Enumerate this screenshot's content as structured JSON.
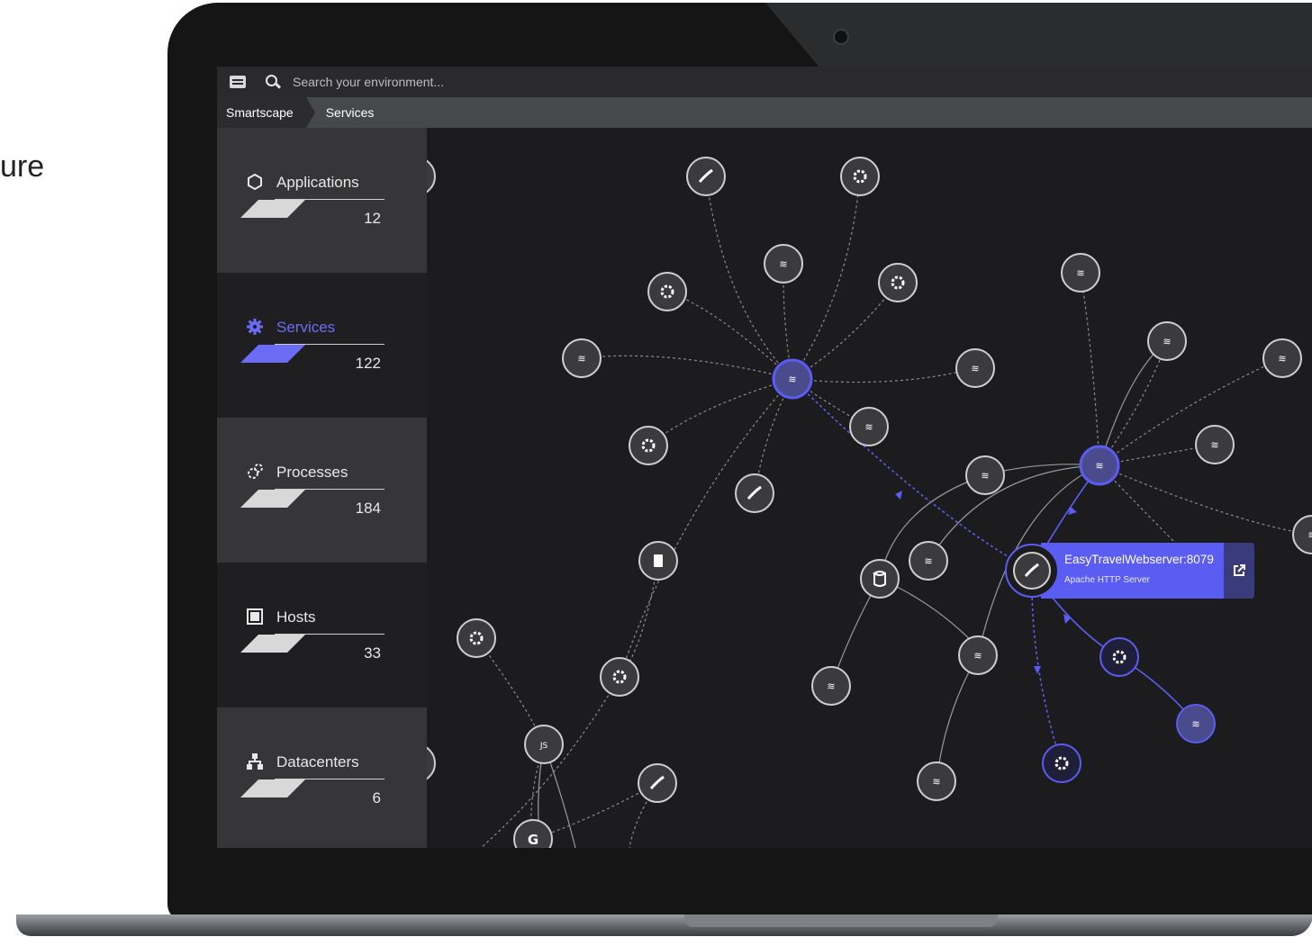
{
  "page": {
    "side_text": "ure"
  },
  "header": {
    "search_placeholder": "Search your environment..."
  },
  "breadcrumb": {
    "items": [
      "Smartscape",
      "Services"
    ]
  },
  "sidebar": {
    "items": [
      {
        "label": "Applications",
        "count": "12",
        "icon": "hexagon-icon",
        "active": false
      },
      {
        "label": "Services",
        "count": "122",
        "icon": "gear-icon",
        "active": true
      },
      {
        "label": "Processes",
        "count": "184",
        "icon": "processes-icon",
        "active": false
      },
      {
        "label": "Hosts",
        "count": "33",
        "icon": "host-icon",
        "active": false
      },
      {
        "label": "Datacenters",
        "count": "6",
        "icon": "datacenter-icon",
        "active": false
      }
    ]
  },
  "tooltip": {
    "name": "EasyTravelWebserver:8079",
    "type": "Apache HTTP Server"
  },
  "colors": {
    "accent": "#5b5cf1",
    "background": "#1c1c1e",
    "node": "#3b3b3d"
  }
}
